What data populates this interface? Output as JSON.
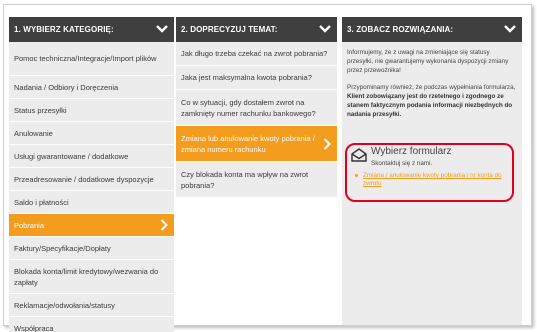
{
  "columns": {
    "categories": {
      "title": "1. WYBIERZ KATEGORIĘ:",
      "items": [
        {
          "label": "Pomoc techniczna/Integracje/Import plików",
          "active": false
        },
        {
          "label": "Nadania / Odbiory i Doręczenia",
          "active": false
        },
        {
          "label": "Status przesyłki",
          "active": false
        },
        {
          "label": "Anulowanie",
          "active": false
        },
        {
          "label": "Usługi gwarantowane / dodatkowe",
          "active": false
        },
        {
          "label": "Przeadresowanie / dodatkowe dyspozycje",
          "active": false
        },
        {
          "label": "Saldo i płatności",
          "active": false
        },
        {
          "label": "Pobrania",
          "active": true
        },
        {
          "label": "Faktury/Specyfikacje/Dopłaty",
          "active": false
        },
        {
          "label": "Blokada konta/limit kredytowy/wezwania do zapłaty",
          "active": false
        },
        {
          "label": "Reklamacje/odwołania/statusy",
          "active": false
        },
        {
          "label": "Współpraca",
          "active": false
        }
      ]
    },
    "topics": {
      "title": "2. DOPRECYZUJ TEMAT:",
      "items": [
        {
          "label": "Jak długo trzeba czekać na zwrot pobrania?",
          "active": false
        },
        {
          "label": "Jaka jest maksymalna kwota pobrania?",
          "active": false
        },
        {
          "label": "Co w sytuacji, gdy dostałem zwrot na zamknięty numer rachunku bankowego?",
          "active": false
        },
        {
          "label": "Zmiana lub anulowanie kwoty pobrania / zmiana numeru rachunku",
          "active": true
        },
        {
          "label": "Czy blokada konta ma wpływ na zwrot pobrania?",
          "active": false
        }
      ]
    },
    "solution": {
      "title": "3. ZOBACZ ROZWIĄZANIA:",
      "para1": "Informujemy, że z uwagi na zmieniające się statusy przesyłki, nie gwarantujemy wykonania dyspozycji zmiany przez przewoźnika!",
      "para2_plain": "Przypominamy również, że podczas wypełniania formularza, ",
      "para2_bold": "Klient zobowiązany jest do rzetelnego i zgodnego ze stanem faktycznym podania informacji niezbędnych do nadania przesyłki.",
      "form": {
        "title": "Wybierz formularz",
        "subtitle": "Skontaktuj się z nami.",
        "link": "Zmiana / anulowanie kwoty pobrania i nr konta do zwrotu"
      }
    }
  },
  "colors": {
    "header_bg": "#3f3f3f",
    "accent": "#f39c1d",
    "list_bg": "#ececec",
    "highlight_border": "#e0001b"
  }
}
